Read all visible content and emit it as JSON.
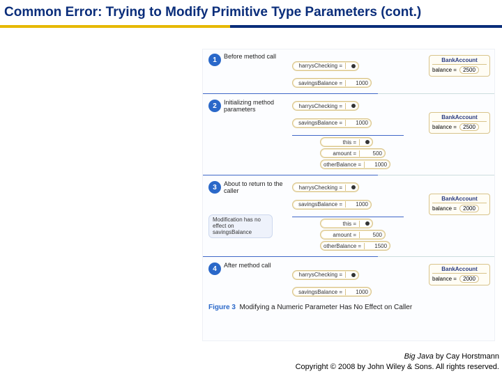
{
  "title": "Common Error: Trying to Modify Primitive Type Parameters (cont.)",
  "figure": {
    "steps": [
      {
        "num": "1",
        "label": "Before method call",
        "vars": [
          {
            "name": "harrysChecking =",
            "val": "",
            "ref": true
          },
          {
            "name": "savingsBalance =",
            "val": "1000"
          }
        ],
        "obj": {
          "title": "BankAccount",
          "field": "balance =",
          "fval": "2500"
        }
      },
      {
        "num": "2",
        "label": "Initializing method parameters",
        "vars": [
          {
            "name": "harrysChecking =",
            "val": "",
            "ref": true
          },
          {
            "name": "savingsBalance =",
            "val": "1000"
          },
          {
            "name": "this =",
            "val": "",
            "ref": true
          },
          {
            "name": "amount =",
            "val": "500"
          },
          {
            "name": "otherBalance =",
            "val": "1000"
          }
        ],
        "obj": {
          "title": "BankAccount",
          "field": "balance =",
          "fval": "2500"
        }
      },
      {
        "num": "3",
        "label": "About to return to the caller",
        "callout": "Modification has no effect on savingsBalance",
        "vars": [
          {
            "name": "harrysChecking =",
            "val": "",
            "ref": true
          },
          {
            "name": "savingsBalance =",
            "val": "1000"
          },
          {
            "name": "this =",
            "val": "",
            "ref": true
          },
          {
            "name": "amount =",
            "val": "500"
          },
          {
            "name": "otherBalance =",
            "val": "1500"
          }
        ],
        "obj": {
          "title": "BankAccount",
          "field": "balance =",
          "fval": "2000"
        }
      },
      {
        "num": "4",
        "label": "After method call",
        "vars": [
          {
            "name": "harrysChecking =",
            "val": "",
            "ref": true
          },
          {
            "name": "savingsBalance =",
            "val": "1000"
          }
        ],
        "obj": {
          "title": "BankAccount",
          "field": "balance =",
          "fval": "2000"
        }
      }
    ],
    "caption_num": "Figure 3",
    "caption_text": "Modifying a Numeric Parameter Has No Effect on Caller"
  },
  "footer": {
    "book": "Big Java",
    "author": " by Cay Horstmann",
    "copyright": "Copyright © 2008 by John Wiley & Sons. All rights reserved."
  }
}
